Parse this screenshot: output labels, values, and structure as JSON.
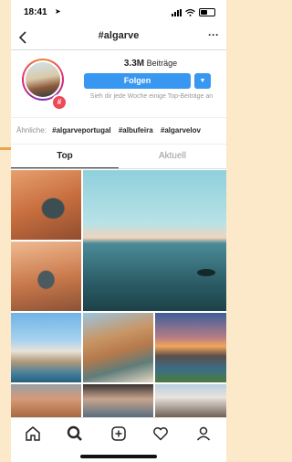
{
  "status_bar": {
    "time": "18:41",
    "location_arrow": "➤"
  },
  "header": {
    "back_icon": "chevron-left-icon",
    "title": "#algarve",
    "more_label": "···"
  },
  "profile": {
    "posts_count": "3.3M",
    "posts_label": "Beiträge",
    "follow_label": "Folgen",
    "dropdown_label": "▼",
    "hint": "Sieh dir jede Woche einige Top-Beiträge an",
    "badge": "#"
  },
  "related": {
    "label": "Ähnliche:",
    "tags": [
      "#algarveportugal",
      "#albufeira",
      "#algarvelov"
    ]
  },
  "tabs": [
    {
      "label": "Top",
      "active": true
    },
    {
      "label": "Aktuell",
      "active": false
    }
  ],
  "colors": {
    "accent": "#3897f0",
    "badge": "#ed4956",
    "background": "#fbe9c9"
  },
  "bottom_nav": [
    "home-icon",
    "search-icon",
    "add-post-icon",
    "heart-icon",
    "profile-icon"
  ]
}
